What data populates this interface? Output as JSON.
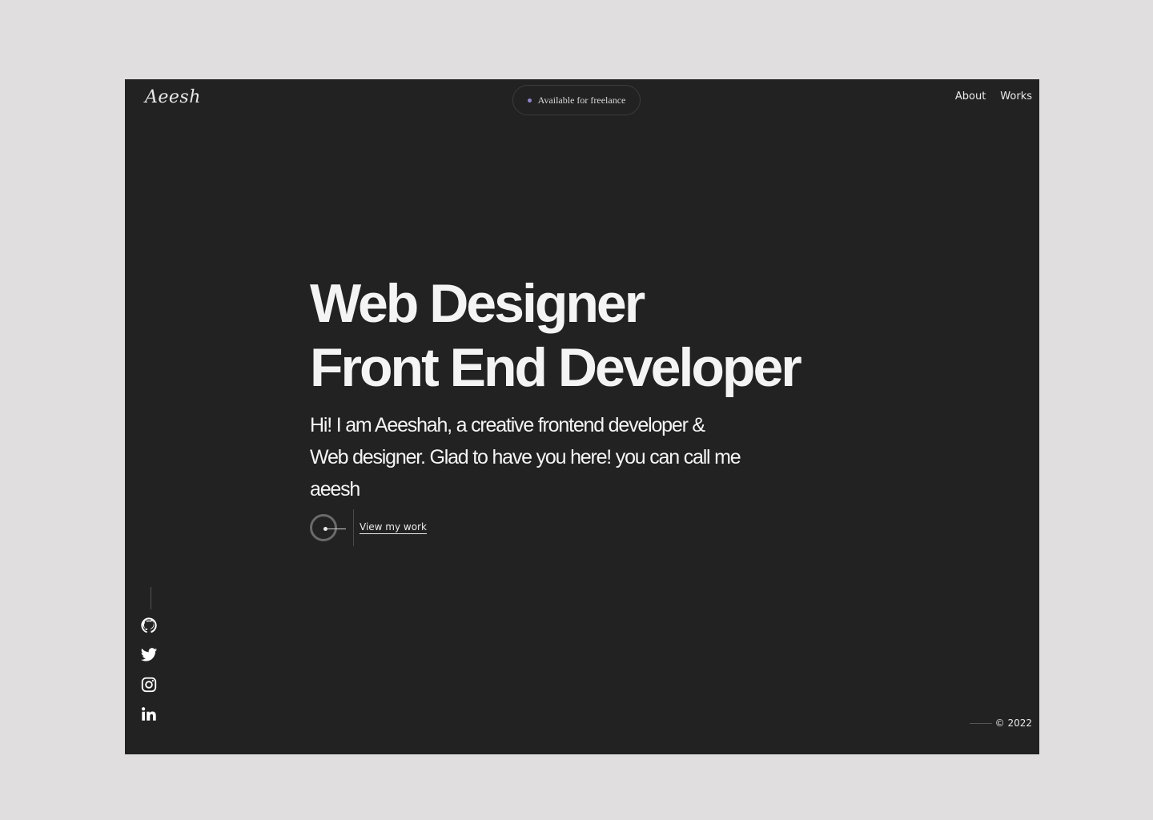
{
  "header": {
    "logo": "Aeesh",
    "status": "Available for freelance",
    "status_dot_color": "#8f86c9",
    "nav": [
      "About",
      "Works"
    ]
  },
  "hero": {
    "headline_line1": "Web Designer",
    "headline_line2": "Front End Developer",
    "intro": "Hi! I am Aeeshah, a creative frontend developer & Web designer. Glad to have you here! you can call me aeesh",
    "cta_label": "View my work"
  },
  "social": {
    "icons": [
      "github-icon",
      "twitter-icon",
      "instagram-icon",
      "linkedin-icon"
    ]
  },
  "footer": {
    "copyright": "© 2022"
  },
  "colors": {
    "page_background": "#e0dedf",
    "frame_background": "#222222",
    "text": "#f4f4f4"
  }
}
